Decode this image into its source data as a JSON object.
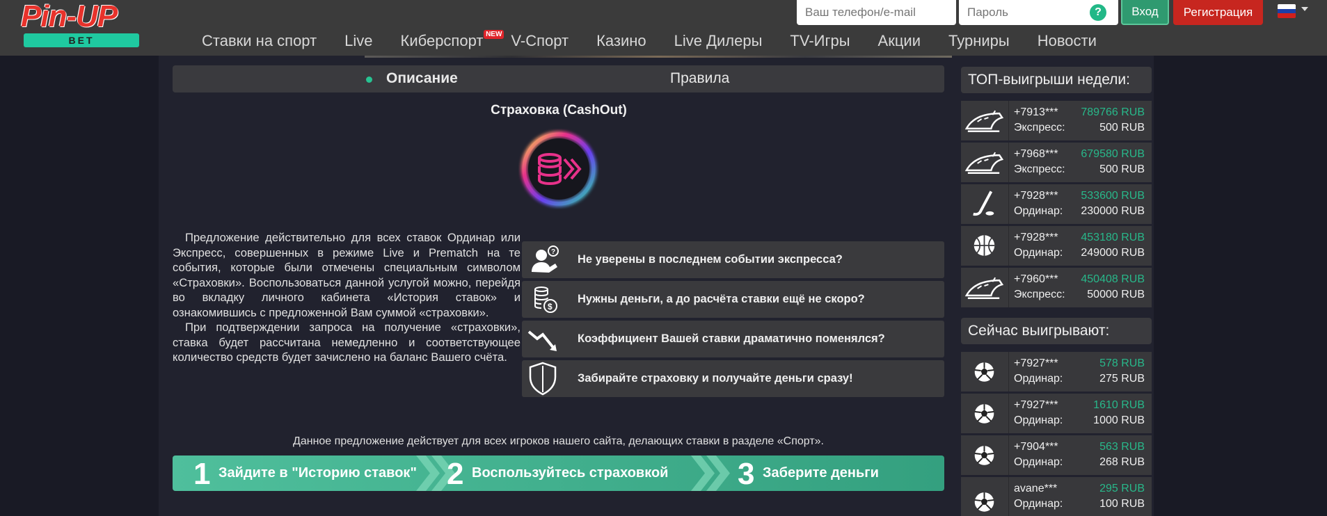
{
  "header": {
    "logo_top": "Pin-UP",
    "logo_bottom": "BET",
    "phone_placeholder": "Ваш телефон/e-mail",
    "password_placeholder": "Пароль",
    "help": "?",
    "login": "Вход",
    "register": "Регистрация",
    "nav": [
      "Ставки на спорт",
      "Live",
      "Киберспорт",
      "V-Спорт",
      "Казино",
      "Live Дилеры",
      "TV-Игры",
      "Акции",
      "Турниры",
      "Новости"
    ],
    "new_badge": "NEW"
  },
  "tabs": {
    "description": "Описание",
    "rules": "Правила"
  },
  "content": {
    "title": "Страховка (CashOut)",
    "paragraph1": "Предложение действительно для всех ставок Ординар или Экспресс, совершенных в режиме Live и Prematch на те события, которые были отмечены специальным символом «Страховки». Воспользоваться данной услугой можно, перейдя во вкладку личного кабинета «История ставок» и ознакомившись с предложенной Вам суммой «страховки».",
    "paragraph2": "При подтверждении запроса на получение «страховки», ставка будет рассчитана немедленно и соответствующее количество средств будет зачислено на баланс Вашего счёта.",
    "features": [
      {
        "icon": "question-person-icon",
        "text": "Не уверены в последнем событии экспресса?"
      },
      {
        "icon": "coins-icon",
        "text": "Нужны деньги, а до расчёта ставки ещё не скоро?"
      },
      {
        "icon": "trend-down-icon",
        "text": "Коэффициент Вашей ставки драматично поменялся?"
      },
      {
        "icon": "shield-icon",
        "text": "Забирайте страховку и получайте деньги сразу!"
      }
    ],
    "offer": "Данное предложение действует для всех игроков нашего сайта, делающих ставки в разделе «Спорт».",
    "steps": [
      {
        "num": "1",
        "label": "Зайдите в \"Историю ставок\""
      },
      {
        "num": "2",
        "label": "Воспользуйтесь страховкой"
      },
      {
        "num": "3",
        "label": "Заберите деньги"
      }
    ]
  },
  "sidebar": {
    "top_title": "ТОП-выигрыши недели:",
    "top": [
      {
        "icon": "train-icon",
        "user": "+7913***",
        "amount": "789766 RUB",
        "type": "Экспресс:",
        "stake": "500 RUB"
      },
      {
        "icon": "train-icon",
        "user": "+7968***",
        "amount": "679580 RUB",
        "type": "Экспресс:",
        "stake": "500 RUB"
      },
      {
        "icon": "hockey-icon",
        "user": "+7928***",
        "amount": "533600 RUB",
        "type": "Ординар:",
        "stake": "230000 RUB"
      },
      {
        "icon": "basketball-icon",
        "user": "+7928***",
        "amount": "453180 RUB",
        "type": "Ординар:",
        "stake": "249000 RUB"
      },
      {
        "icon": "train-icon",
        "user": "+7960***",
        "amount": "450408 RUB",
        "type": "Экспресс:",
        "stake": "50000 RUB"
      }
    ],
    "now_title": "Сейчас выигрывают:",
    "now": [
      {
        "icon": "soccer-ball-icon",
        "user": "+7927***",
        "amount": "578 RUB",
        "type": "Ординар:",
        "stake": "275 RUB"
      },
      {
        "icon": "soccer-ball-icon",
        "user": "+7927***",
        "amount": "1610 RUB",
        "type": "Ординар:",
        "stake": "1000 RUB"
      },
      {
        "icon": "soccer-ball-icon",
        "user": "+7904***",
        "amount": "563 RUB",
        "type": "Ординар:",
        "stake": "268 RUB"
      },
      {
        "icon": "soccer-ball-icon",
        "user": "avane***",
        "amount": "295 RUB",
        "type": "Ординар:",
        "stake": "100 RUB"
      }
    ]
  },
  "colors": {
    "accent": "#28b88a",
    "register": "#c7261f",
    "login": "#2f9a70",
    "step_bg": "#4fbf9c"
  }
}
